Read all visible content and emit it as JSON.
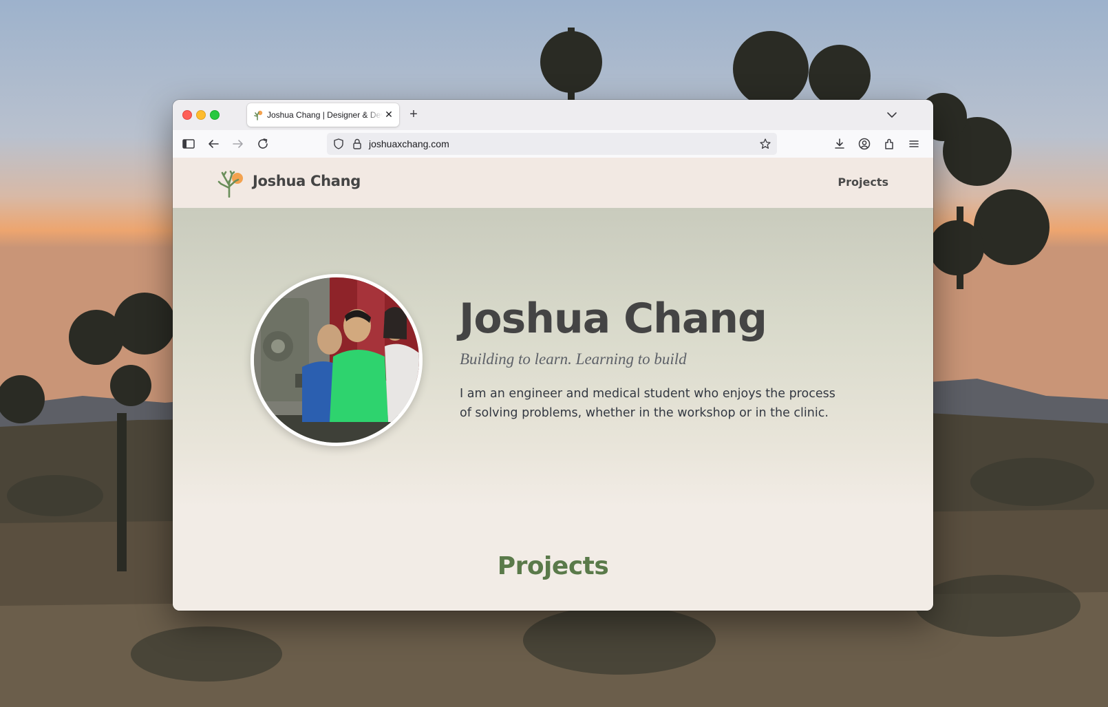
{
  "browser": {
    "tab_title": "Joshua Chang | Designer & Developer",
    "new_tab_label": "+",
    "close_tab_label": "✕",
    "url": "joshuaxchang.com"
  },
  "site": {
    "brand": "Joshua Chang",
    "nav": {
      "projects_link": "Projects"
    },
    "hero": {
      "name": "Joshua Chang",
      "tagline": "Building to learn. Learning to build",
      "bio": "I am an engineer and medical student who enjoys the process of solving problems, whether in the workshop or in the clinic."
    },
    "projects_heading": "Projects"
  },
  "colors": {
    "accent_green": "#5a7a4a",
    "nav_bg": "#f2e9e3",
    "hero_bg_top": "#c9cbbd"
  },
  "icons": [
    "sidebar-icon",
    "back-icon",
    "forward-icon",
    "reload-icon",
    "shield-icon",
    "lock-icon",
    "bookmark-star-icon",
    "download-icon",
    "account-icon",
    "extensions-icon",
    "menu-icon",
    "tab-list-chevron-icon",
    "joshua-tree-logo-icon"
  ]
}
